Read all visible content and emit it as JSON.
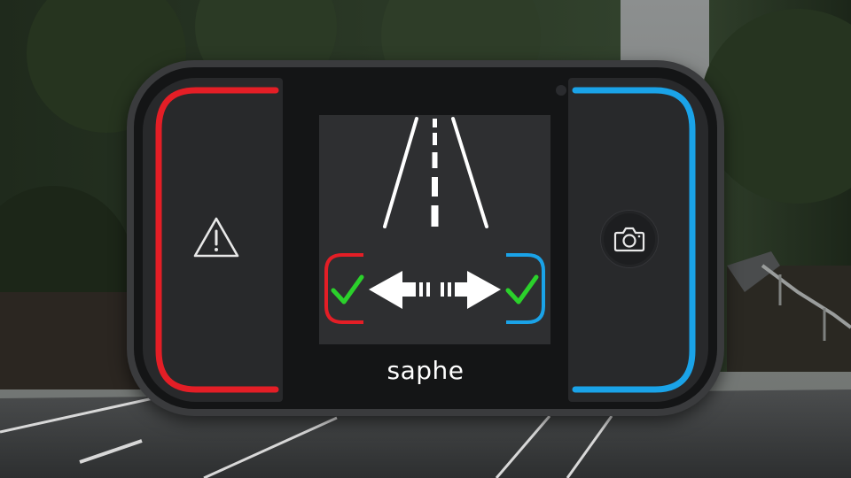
{
  "device": {
    "brand_label": "saphe",
    "left_button_icon": "warning-triangle-icon",
    "right_button_icon": "camera-icon",
    "display_icons": [
      "road-icon",
      "left-check-icon",
      "double-arrow-icon",
      "right-check-icon"
    ]
  },
  "colors": {
    "left_accent": "#e41e26",
    "right_accent": "#1aa3e8",
    "check": "#2bd12b",
    "screen_bg": "#2e2f31"
  }
}
